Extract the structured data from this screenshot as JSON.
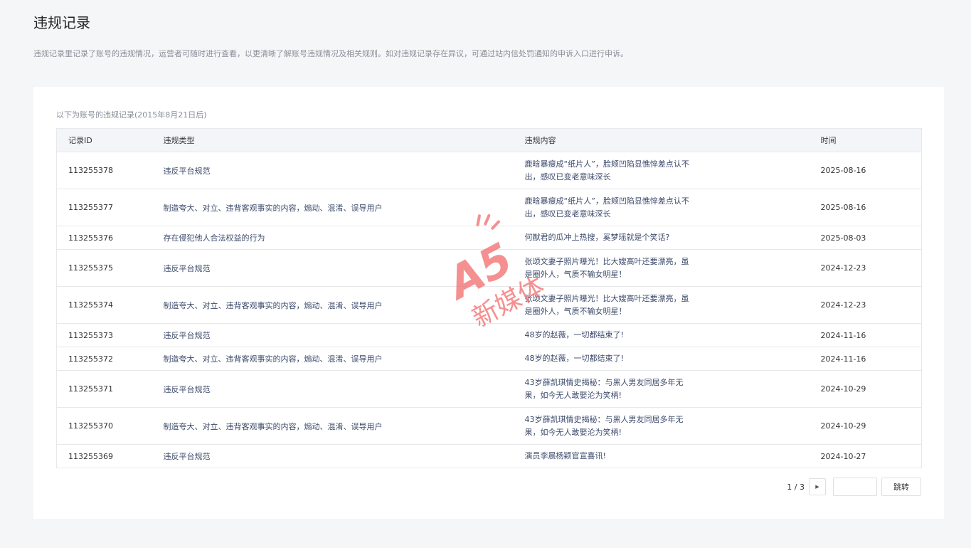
{
  "header": {
    "title": "违规记录",
    "description": "违规记录里记录了账号的违规情况，运营者可随时进行查看，以更清晰了解账号违规情况及相关规则。如对违规记录存在异议，可通过站内信处罚通知的申诉入口进行申诉。"
  },
  "table": {
    "caption": "以下为账号的违规记录(2015年8月21日后)",
    "columns": [
      "记录ID",
      "违规类型",
      "违规内容",
      "时间"
    ],
    "rows": [
      {
        "id": "113255378",
        "type": "违反平台规范",
        "content": "鹿晗暴瘦成“纸片人”，脸颊凹陷显憔悴差点认不出，感叹已变老意味深长",
        "time": "2025-08-16"
      },
      {
        "id": "113255377",
        "type": "制造夸大、对立、违背客观事实的内容，煽动、混淆、误导用户",
        "content": "鹿晗暴瘦成“纸片人”，脸颊凹陷显憔悴差点认不出，感叹已变老意味深长",
        "time": "2025-08-16"
      },
      {
        "id": "113255376",
        "type": "存在侵犯他人合法权益的行为",
        "content": "何猷君的瓜冲上热搜，奚梦瑶就是个笑话?",
        "time": "2025-08-03"
      },
      {
        "id": "113255375",
        "type": "违反平台规范",
        "content": "张颂文妻子照片曝光！比大嫂高叶还要漂亮，虽是圈外人，气质不输女明星！",
        "time": "2024-12-23"
      },
      {
        "id": "113255374",
        "type": "制造夸大、对立、违背客观事实的内容，煽动、混淆、误导用户",
        "content": "张颂文妻子照片曝光！比大嫂高叶还要漂亮，虽是圈外人，气质不输女明星！",
        "time": "2024-12-23"
      },
      {
        "id": "113255373",
        "type": "违反平台规范",
        "content": "48岁的赵薇，一切都结束了!",
        "time": "2024-11-16"
      },
      {
        "id": "113255372",
        "type": "制造夸大、对立、违背客观事实的内容，煽动、混淆、误导用户",
        "content": "48岁的赵薇，一切都结束了!",
        "time": "2024-11-16"
      },
      {
        "id": "113255371",
        "type": "违反平台规范",
        "content": "43岁薛凯琪情史揭秘：与黑人男友同居多年无果，如今无人敢娶沦为笑柄!",
        "time": "2024-10-29"
      },
      {
        "id": "113255370",
        "type": "制造夸大、对立、违背客观事实的内容，煽动、混淆、误导用户",
        "content": "43岁薛凯琪情史揭秘：与黑人男友同居多年无果，如今无人敢娶沦为笑柄!",
        "time": "2024-10-29"
      },
      {
        "id": "113255369",
        "type": "违反平台规范",
        "content": "演员李晨杨颖官宣喜讯!",
        "time": "2024-10-27"
      }
    ]
  },
  "pagination": {
    "info": "1 / 3",
    "next_icon": "caret-right-icon",
    "input_value": "",
    "jump_label": "跳转"
  },
  "watermark": {
    "logo_text": "A5",
    "sub_text": "新媒体",
    "color": "#f26b6b"
  }
}
